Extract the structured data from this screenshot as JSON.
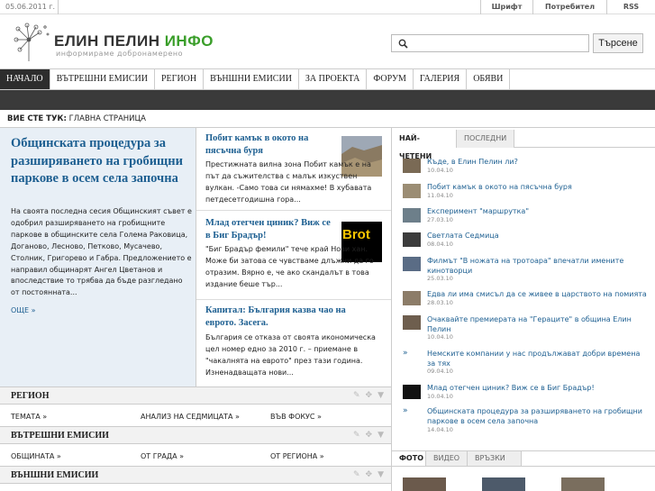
{
  "topbar": {
    "date": "05.06.2011 г.",
    "links": [
      "Шрифт",
      "Потребител",
      "RSS"
    ]
  },
  "header": {
    "logo_title_a": "ЕЛИН ПЕЛИН ",
    "logo_title_b": "ИНФО",
    "logo_tagline": "информираме добронамерено",
    "search_placeholder": "",
    "search_button": "Търсене"
  },
  "nav": [
    "НАЧАЛО",
    "ВЪТРЕШНИ ЕМИСИИ",
    "РЕГИОН",
    "ВЪНШНИ ЕМИСИИ",
    "ЗА ПРОЕКТА",
    "ФОРУМ",
    "ГАЛЕРИЯ",
    "ОБЯВИ"
  ],
  "breadcrumb": {
    "label": "ВИЕ СТЕ ТУК:",
    "current": "ГЛАВНА СТРАНИЦА"
  },
  "feature": {
    "title": "Общинската процедура за разширяването на гробищни паркове в осем села започна",
    "text": "На своята последна сесия Общинският съвет е одобрил разширяването на гробищните паркове в общинските села Голема Раковица, Доганово, Лесново, Петково, Мусачево, Столник, Григорево и Габра. Предложението е направил общинарят Ангел Цветанов и впоследствие то трябва да бъде разгледано от постоянната...",
    "more": "ОЩЕ »"
  },
  "articles": [
    {
      "title": "Побит камък в окото на пясъчна буря",
      "text": "Престижната вилна зона Побит камък е на път да съжителства с малък изкуствен вулкан. -Само това си нямахме! В хубавата петдесетгодишна гора..."
    },
    {
      "title": "Млад отегчен циник? Виж се в Биг Брадър!",
      "text": "\"Биг Брадър фемили\" тече край Нови хан. Може би затова се чувстваме длъжни да го отразим. Вярно е, че ако скандалът в това издание беше тър..."
    },
    {
      "title": "Капитал: България казва чао на еврото. Засега.",
      "text": "България се отказа от своята икономическа цел номер едно за 2010 г. – приемане в \"чакалнята на еврото\" през тази година. Изненадващата нови..."
    }
  ],
  "thumb_brand": "Brot",
  "right": {
    "tabs": [
      "НАЙ-ЧЕТЕНИ",
      "ПОСЛЕДНИ"
    ],
    "items": [
      {
        "title": "Къде, в Елин Пелин ли?",
        "date": "10.04.10"
      },
      {
        "title": "Побит камък в окото на пясъчна буря",
        "date": "11.04.10"
      },
      {
        "title": "Експеримент \"маршрутка\"",
        "date": "27.03.10"
      },
      {
        "title": "Светлата Седмица",
        "date": "08.04.10"
      },
      {
        "title": "Филмът \"В ножата на тротоара\" впечатли имените кинотворци",
        "date": "25.03.10"
      },
      {
        "title": "Едва ли има смисъл да се живее в царството на помията",
        "date": "28.03.10"
      },
      {
        "title": "Очаквайте премиерата на \"Гераците\" в община Елин Пелин",
        "date": "10.04.10"
      },
      {
        "title": "Немските компании у нас продължават добри времена за тях",
        "date": "09.04.10"
      },
      {
        "title": "Млад отегчен циник? Виж се в Биг Брадър!",
        "date": "10.04.10"
      },
      {
        "title": "Общинската процедура за разширяването на гробищни паркове в осем села започна",
        "date": "14.04.10"
      }
    ],
    "bottom_tabs": [
      "ФОТО",
      "ВИДЕО",
      "ВРЪЗКИ"
    ]
  },
  "sections": [
    {
      "title": "РЕГИОН",
      "links": [
        "ТЕМАТА »",
        "АНАЛИЗ НА СЕДМИЦАТА »",
        "ВЪВ ФОКУС »"
      ]
    },
    {
      "title": "ВЪТРЕШНИ ЕМИСИИ",
      "links": [
        "ОБЩИНАТА »",
        "ОТ ГРАДА »",
        "ОТ РЕГИОНА »"
      ]
    },
    {
      "title": "ВЪНШНИ ЕМИСИИ",
      "links": []
    }
  ]
}
